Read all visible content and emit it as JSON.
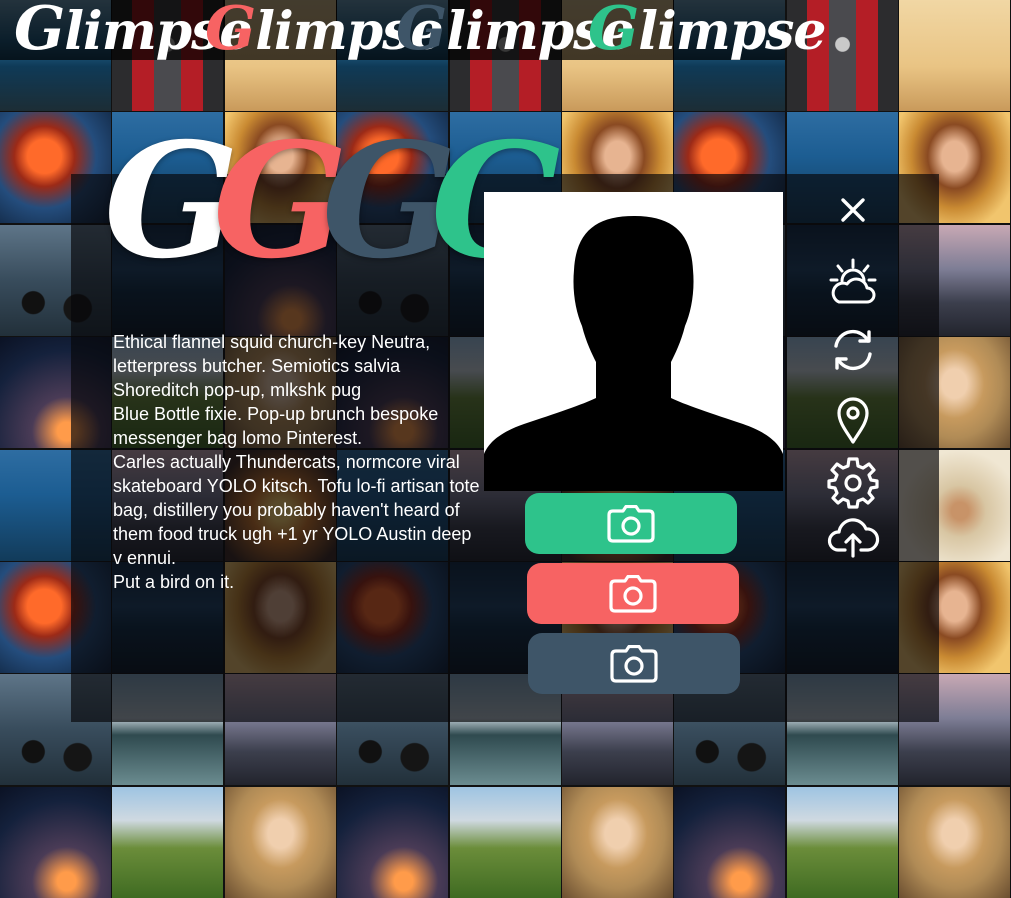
{
  "header": {
    "brand_repeats": [
      {
        "initial": "G",
        "rest": "limpse",
        "initial_color": "#ffffff"
      },
      {
        "initial": "G",
        "rest": "limpse",
        "initial_color": "#f76363"
      },
      {
        "initial": "G",
        "rest": "limpse",
        "initial_color": "#3e5568"
      },
      {
        "initial": "G",
        "rest": "limpse",
        "initial_color": "#2ec38b"
      }
    ]
  },
  "logo": {
    "letters": [
      {
        "char": "G",
        "color": "#ffffff"
      },
      {
        "char": "G",
        "color": "#f76363"
      },
      {
        "char": "G",
        "color": "#3e5568"
      },
      {
        "char": "G",
        "color": "#2ec38b"
      }
    ]
  },
  "bio": {
    "paragraphs": [
      "Ethical flannel squid church-key Neutra, letterpress butcher. Semiotics salvia Shoreditch pop-up, mlkshk pug",
      "Blue Bottle fixie. Pop-up brunch bespoke messenger bag lomo Pinterest.",
      "Carles actually Thundercats, normcore viral skateboard YOLO kitsch. Tofu lo-fi artisan tote bag, distillery you probably haven't heard of them food truck ugh +1 yr YOLO Austin deep v ennui.",
      "Put a bird on it."
    ]
  },
  "camera_buttons": [
    {
      "icon": "camera-icon",
      "color": "#2ec38b"
    },
    {
      "icon": "camera-icon",
      "color": "#f76363"
    },
    {
      "icon": "camera-icon",
      "color": "#3e5568"
    }
  ],
  "toolbar": [
    {
      "icon": "close-icon"
    },
    {
      "icon": "weather-icon"
    },
    {
      "icon": "sync-icon"
    },
    {
      "icon": "location-pin-icon"
    },
    {
      "icon": "settings-gear-icon"
    },
    {
      "icon": "cloud-upload-icon"
    }
  ],
  "colors": {
    "white": "#ffffff",
    "coral": "#f76363",
    "slate": "#3e5568",
    "mint": "#2ec38b"
  }
}
